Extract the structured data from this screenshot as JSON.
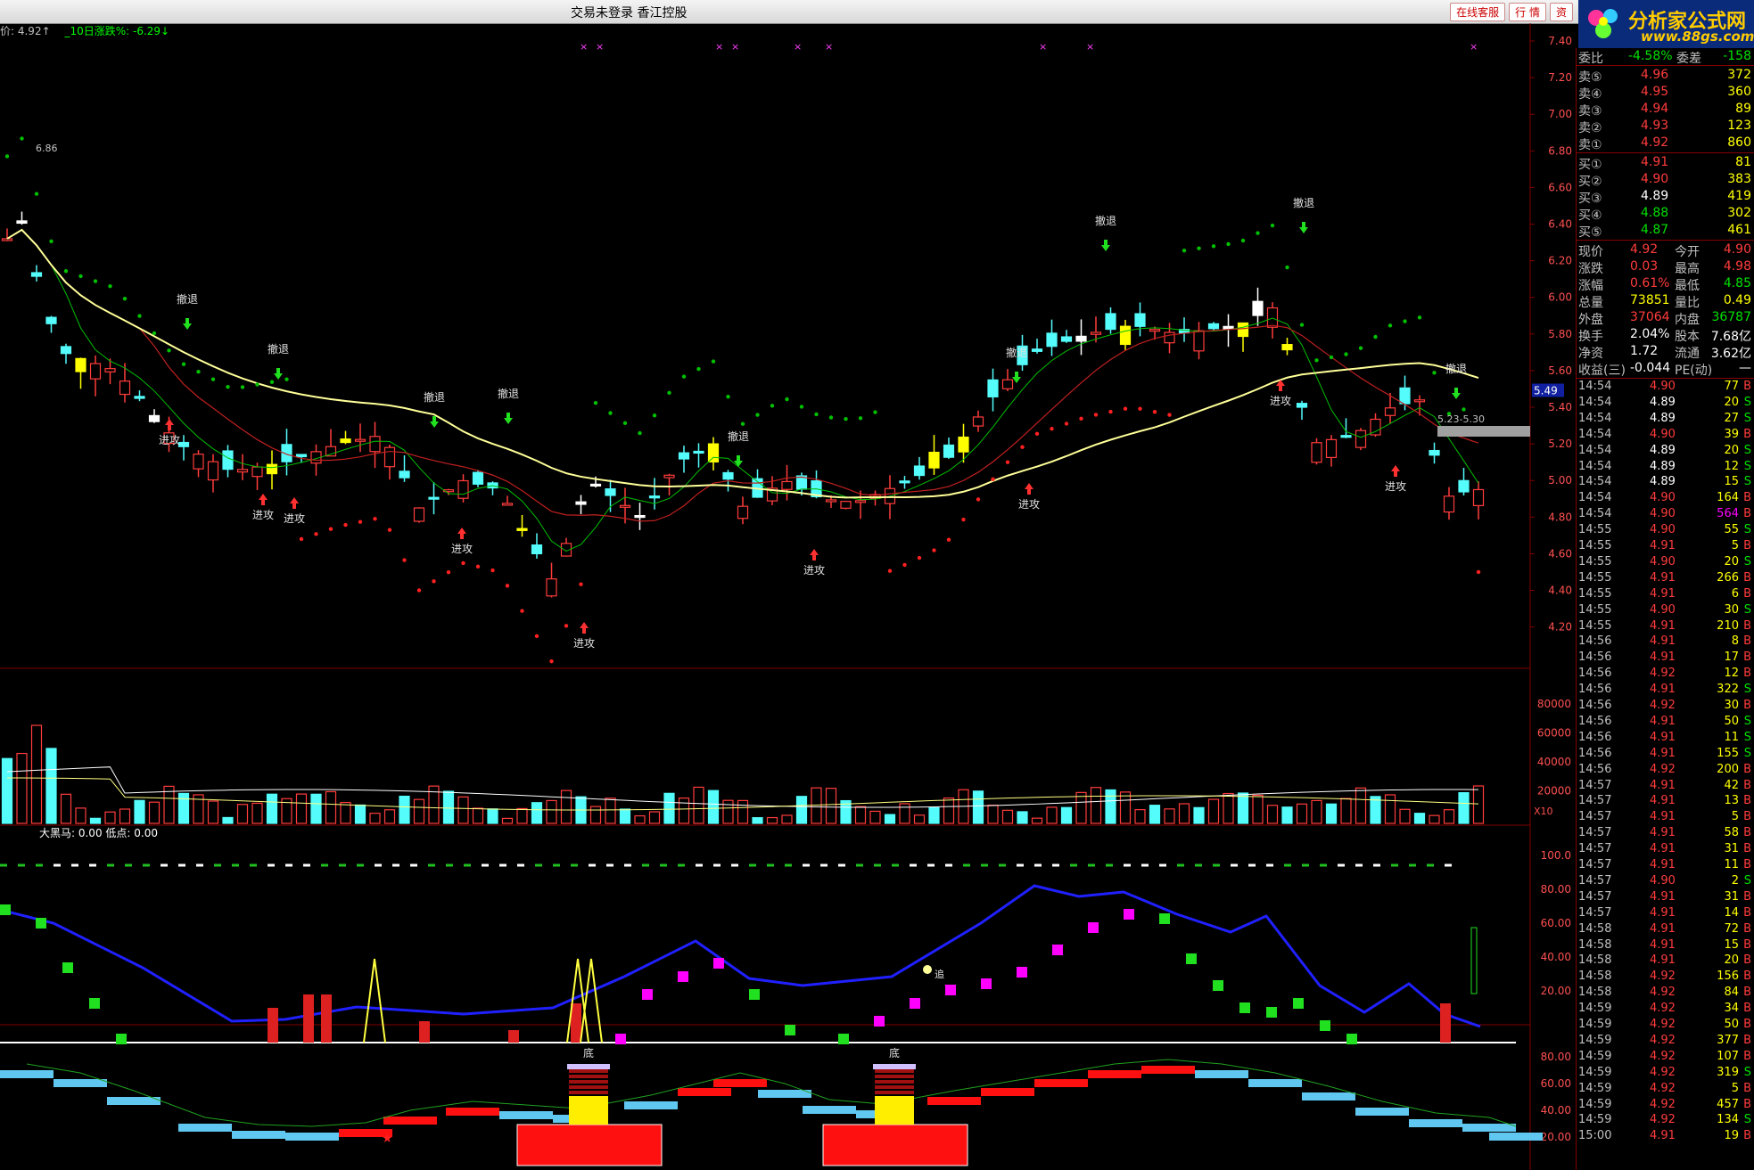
{
  "window": {
    "title": "交易未登录  香江控股",
    "buttons": [
      "在线客服",
      "行 情",
      "资"
    ]
  },
  "logo": {
    "name": "分析家公式网",
    "url_text": "www.88gs.com"
  },
  "legend": {
    "price": "价: 4.92↑",
    "change": "_10日涨跌%: -6.29↓"
  },
  "indicator_label": "大黑马: 0.00  低点: 0.00",
  "price_axis": [
    "7.40",
    "7.20",
    "7.00",
    "6.80",
    "6.60",
    "6.40",
    "6.20",
    "6.00",
    "5.80",
    "5.60",
    "5.40",
    "5.20",
    "5.00",
    "4.80",
    "4.60",
    "4.40",
    "4.20"
  ],
  "price_marker": "5.49",
  "range_label": "5.23-5.30",
  "high_label": "6.86",
  "volume_axis": [
    "80000",
    "60000",
    "40000",
    "20000",
    "X10"
  ],
  "ind1_axis": [
    "100.0",
    "80.00",
    "60.00",
    "40.00",
    "20.00"
  ],
  "ind2_axis": [
    "80.00",
    "60.00",
    "40.00",
    "20.00"
  ],
  "annotations": {
    "attack": "进攻",
    "retreat": "撤退",
    "bottom": "底",
    "add": "追"
  },
  "quote": {
    "wei": {
      "label": "委比",
      "value": "-4.58%",
      "label2": "委差",
      "value2": "-158"
    },
    "sells": [
      {
        "label": "卖⑤",
        "price": "4.96",
        "vol": "372"
      },
      {
        "label": "卖④",
        "price": "4.95",
        "vol": "360"
      },
      {
        "label": "卖③",
        "price": "4.94",
        "vol": "89"
      },
      {
        "label": "卖②",
        "price": "4.93",
        "vol": "123"
      },
      {
        "label": "卖①",
        "price": "4.92",
        "vol": "860"
      }
    ],
    "buys": [
      {
        "label": "买①",
        "price": "4.91",
        "vol": "81"
      },
      {
        "label": "买②",
        "price": "4.90",
        "vol": "383"
      },
      {
        "label": "买③",
        "price": "4.89",
        "vol": "419"
      },
      {
        "label": "买④",
        "price": "4.88",
        "vol": "302"
      },
      {
        "label": "买⑤",
        "price": "4.87",
        "vol": "461"
      }
    ],
    "stats": [
      {
        "l1": "现价",
        "v1": "4.92",
        "l2": "今开",
        "v2": "4.90"
      },
      {
        "l1": "涨跌",
        "v1": "0.03",
        "l2": "最高",
        "v2": "4.98"
      },
      {
        "l1": "涨幅",
        "v1": "0.61%",
        "l2": "最低",
        "v2": "4.85"
      },
      {
        "l1": "总量",
        "v1": "73851",
        "l2": "量比",
        "v2": "0.49"
      },
      {
        "l1": "外盘",
        "v1": "37064",
        "l2": "内盘",
        "v2": "36787"
      },
      {
        "l1": "换手",
        "v1": "2.04%",
        "l2": "股本",
        "v2": "7.68亿"
      },
      {
        "l1": "净资",
        "v1": "1.72",
        "l2": "流通",
        "v2": "3.62亿"
      },
      {
        "l1": "收益(三)",
        "v1": "-0.044",
        "l2": "PE(动)",
        "v2": "—"
      }
    ],
    "ticks": [
      {
        "t": "14:54",
        "p": "4.90",
        "v": "77",
        "s": "B"
      },
      {
        "t": "14:54",
        "p": "4.89",
        "v": "20",
        "s": "S"
      },
      {
        "t": "14:54",
        "p": "4.89",
        "v": "27",
        "s": "S"
      },
      {
        "t": "14:54",
        "p": "4.90",
        "v": "39",
        "s": "B"
      },
      {
        "t": "14:54",
        "p": "4.89",
        "v": "20",
        "s": "S"
      },
      {
        "t": "14:54",
        "p": "4.89",
        "v": "12",
        "s": "S"
      },
      {
        "t": "14:54",
        "p": "4.89",
        "v": "15",
        "s": "S"
      },
      {
        "t": "14:54",
        "p": "4.90",
        "v": "164",
        "s": "B"
      },
      {
        "t": "14:54",
        "p": "4.90",
        "v": "564",
        "s": "B"
      },
      {
        "t": "14:55",
        "p": "4.90",
        "v": "55",
        "s": "S"
      },
      {
        "t": "14:55",
        "p": "4.91",
        "v": "5",
        "s": "B"
      },
      {
        "t": "14:55",
        "p": "4.90",
        "v": "20",
        "s": "S"
      },
      {
        "t": "14:55",
        "p": "4.91",
        "v": "266",
        "s": "B"
      },
      {
        "t": "14:55",
        "p": "4.91",
        "v": "6",
        "s": "B"
      },
      {
        "t": "14:55",
        "p": "4.90",
        "v": "30",
        "s": "S"
      },
      {
        "t": "14:55",
        "p": "4.91",
        "v": "210",
        "s": "B"
      },
      {
        "t": "14:56",
        "p": "4.91",
        "v": "8",
        "s": "B"
      },
      {
        "t": "14:56",
        "p": "4.91",
        "v": "17",
        "s": "B"
      },
      {
        "t": "14:56",
        "p": "4.92",
        "v": "12",
        "s": "B"
      },
      {
        "t": "14:56",
        "p": "4.91",
        "v": "322",
        "s": "S"
      },
      {
        "t": "14:56",
        "p": "4.92",
        "v": "30",
        "s": "B"
      },
      {
        "t": "14:56",
        "p": "4.91",
        "v": "50",
        "s": "S"
      },
      {
        "t": "14:56",
        "p": "4.91",
        "v": "11",
        "s": "S"
      },
      {
        "t": "14:56",
        "p": "4.91",
        "v": "155",
        "s": "S"
      },
      {
        "t": "14:56",
        "p": "4.92",
        "v": "200",
        "s": "B"
      },
      {
        "t": "14:57",
        "p": "4.91",
        "v": "42",
        "s": "B"
      },
      {
        "t": "14:57",
        "p": "4.91",
        "v": "13",
        "s": "B"
      },
      {
        "t": "14:57",
        "p": "4.91",
        "v": "5",
        "s": "B"
      },
      {
        "t": "14:57",
        "p": "4.91",
        "v": "58",
        "s": "B"
      },
      {
        "t": "14:57",
        "p": "4.91",
        "v": "31",
        "s": "B"
      },
      {
        "t": "14:57",
        "p": "4.91",
        "v": "11",
        "s": "B"
      },
      {
        "t": "14:57",
        "p": "4.90",
        "v": "2",
        "s": "S"
      },
      {
        "t": "14:57",
        "p": "4.91",
        "v": "31",
        "s": "B"
      },
      {
        "t": "14:57",
        "p": "4.91",
        "v": "14",
        "s": "B"
      },
      {
        "t": "14:58",
        "p": "4.91",
        "v": "72",
        "s": "B"
      },
      {
        "t": "14:58",
        "p": "4.91",
        "v": "15",
        "s": "B"
      },
      {
        "t": "14:58",
        "p": "4.91",
        "v": "20",
        "s": "B"
      },
      {
        "t": "14:58",
        "p": "4.92",
        "v": "156",
        "s": "B"
      },
      {
        "t": "14:58",
        "p": "4.92",
        "v": "84",
        "s": "B"
      },
      {
        "t": "14:59",
        "p": "4.92",
        "v": "34",
        "s": "B"
      },
      {
        "t": "14:59",
        "p": "4.92",
        "v": "50",
        "s": "B"
      },
      {
        "t": "14:59",
        "p": "4.92",
        "v": "377",
        "s": "B"
      },
      {
        "t": "14:59",
        "p": "4.92",
        "v": "107",
        "s": "B"
      },
      {
        "t": "14:59",
        "p": "4.92",
        "v": "319",
        "s": "S"
      },
      {
        "t": "14:59",
        "p": "4.92",
        "v": "5",
        "s": "B"
      },
      {
        "t": "14:59",
        "p": "4.92",
        "v": "457",
        "s": "B"
      },
      {
        "t": "14:59",
        "p": "4.92",
        "v": "134",
        "s": "S"
      },
      {
        "t": "15:00",
        "p": "4.91",
        "v": "19",
        "s": "B"
      }
    ]
  },
  "colors": {
    "up": "#ff3c3c",
    "down": "#00e000",
    "cyan": "#54fcfc",
    "yellow": "#ffff00",
    "ma_yellow": "#ffff99",
    "magenta": "#ff00ff",
    "blue": "#0000ff",
    "grid_red": "#800000"
  }
}
